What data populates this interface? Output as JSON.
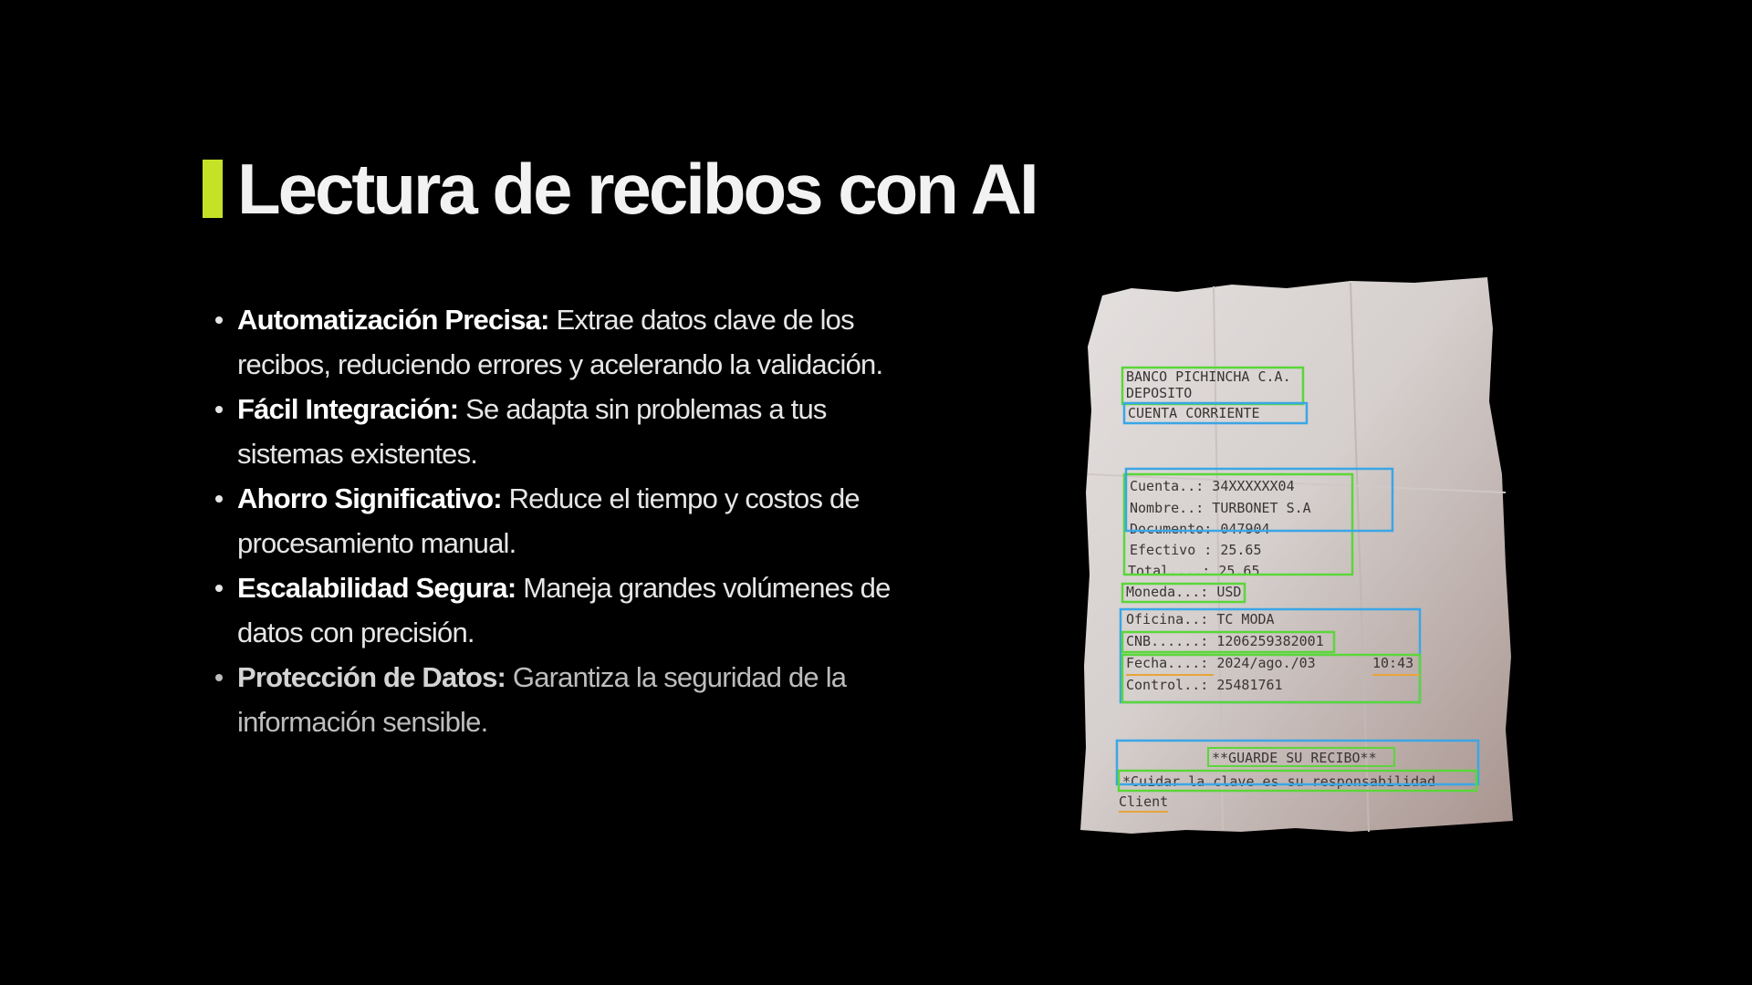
{
  "title": "Lectura de recibos con AI",
  "colors": {
    "accent": "#c6e227",
    "background": "#000000",
    "box_green": "#5bd63a",
    "box_blue": "#3aa6e6",
    "underline_orange": "#e8a43a"
  },
  "bullets": [
    {
      "label": "Automatización Precisa:",
      "text": " Extrae datos clave de los recibos, reduciendo errores y acelerando la validación."
    },
    {
      "label": "Fácil Integración:",
      "text": " Se adapta sin problemas a tus sistemas existentes."
    },
    {
      "label": "Ahorro Significativo:",
      "text": " Reduce el tiempo y costos de procesamiento manual."
    },
    {
      "label": "Escalabilidad Segura:",
      "text": " Maneja grandes volúmenes de datos con precisión."
    },
    {
      "label": "Protección de Datos:",
      "text": " Garantiza la seguridad de la información sensible."
    }
  ],
  "receipt": {
    "lines": [
      "BANCO PICHINCHA C.A.",
      "DEPOSITO",
      "CUENTA CORRIENTE",
      "Cuenta..: 34XXXXXX04",
      "Nombre..: TURBONET S.A",
      "Documento: 047904",
      "Efectivo : 25.65",
      "Total....: 25.65",
      "Moneda...: USD",
      "Oficina..: TC MODA",
      "CNB......: 1206259382001",
      "Fecha....: 2024/ago./03",
      "10:43",
      "Control..: 25481761",
      "**GUARDE SU RECIBO**",
      "*Cuidar la clave es su responsabilidad",
      "Client"
    ]
  }
}
